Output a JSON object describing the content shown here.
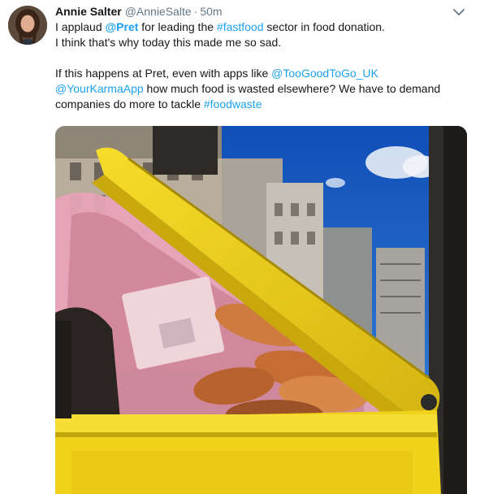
{
  "tweet": {
    "author_name": "Annie Salter",
    "author_handle": "@AnnieSalte",
    "separator": "·",
    "timestamp": "50m",
    "line1": {
      "t1": "I applaud ",
      "mention_pret": "@Pret",
      "t2": " for leading the ",
      "hashtag_fastfood": "#fastfood",
      "t3": " sector in food donation."
    },
    "line2": "I think that's why today this made me so sad.",
    "para2": {
      "t1": "If this happens at Pret, even with apps like ",
      "mention_tgtg": "@TooGoodToGo_UK",
      "t2": " ",
      "mention_karma": "@YourKarmaApp",
      "t3": " how much food is wasted elsewhere? We have to demand companies do more to tackle ",
      "hashtag_foodwaste": "#foodwaste"
    }
  },
  "icons": {
    "avatar": "profile-photo",
    "caret": "chevron-down-icon"
  },
  "colors": {
    "link": "#1da1f2",
    "secondary_text": "#657786",
    "bin_yellow": "#f2d31b",
    "sky_blue": "#1c5fc4"
  }
}
